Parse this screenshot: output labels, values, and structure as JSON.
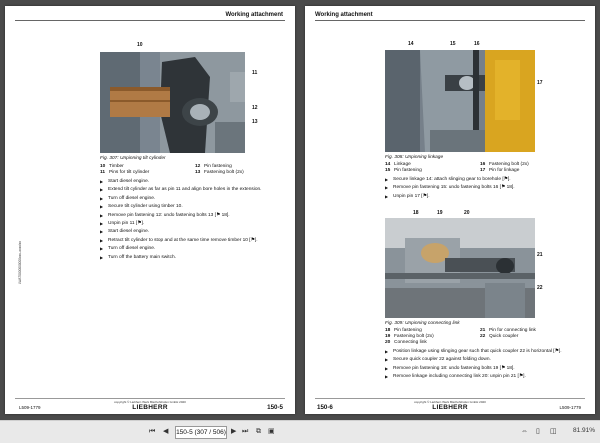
{
  "header_title": "Working attachment",
  "left_page": {
    "callouts": {
      "c10": "10",
      "c11": "11",
      "c12": "12",
      "c13": "13"
    },
    "caption": "Fig. 307: Unpinning tilt cylinder",
    "legend": [
      [
        "10",
        "Timber",
        "12",
        "Pin fastening"
      ],
      [
        "11",
        "Pins for tilt cylinder",
        "13",
        "Fastening bolt (2x)"
      ]
    ],
    "steps": [
      "Start diesel engine.",
      "Extend tilt cylinder as far as pin 11 and align bore holes in the extension.",
      "Turn off diesel engine.",
      "Secure tilt cylinder using timber 10.",
      "Remove pin fastening 12: undo fastening bolts 13 [⚑ 18].",
      "Unpin pin 11 [⚑].",
      "Start diesel engine.",
      "Retract tilt cylinder to stop and at the same time remove timber 10 [⚑].",
      "Turn off diesel engine.",
      "Turn off the battery main switch."
    ],
    "side_code": "LWAT0000000000xxx–xxxx/xx",
    "footer_code": "L509-1779",
    "footer_copy": "copyright © Liebherr-Werk Bischofshofen GmbH 2020",
    "footer_logo": "LIEBHERR",
    "page_number": "150-5"
  },
  "right_page": {
    "fig1_callouts": {
      "c14": "14",
      "c15": "15",
      "c16": "16",
      "c17": "17"
    },
    "fig1_caption": "Fig. 308: Unpinning linkage",
    "fig1_legend": [
      [
        "14",
        "Linkage",
        "16",
        "Fastening bolt (2x)"
      ],
      [
        "15",
        "Pin fastening",
        "17",
        "Pin for linkage"
      ]
    ],
    "fig1_steps": [
      "Secure linkage 14: attach slinging gear to borehole [⚑].",
      "Remove pin fastening 15: undo fastening bolts 16 [⚑ 18].",
      "Unpin pin 17 [⚑]."
    ],
    "fig2_callouts": {
      "c18": "18",
      "c19": "19",
      "c20": "20",
      "c21": "21",
      "c22": "22"
    },
    "fig2_caption": "Fig. 309: Unpinning connecting link",
    "fig2_legend": [
      [
        "18",
        "Pin fastening",
        "21",
        "Pin for connecting link"
      ],
      [
        "19",
        "Fastening bolt (2x)",
        "22",
        "Quick coupler"
      ],
      [
        "20",
        "Connecting link",
        "",
        ""
      ]
    ],
    "fig2_steps": [
      "Position linkage using slinging gear such that quick coupler 22 is horizontal [⚑].",
      "Secure quick coupler 22 against folding down.",
      "Remove pin fastening 18: undo fastening bolts 19 [⚑ 18].",
      "Remove linkage including connecting link 20: unpin pin 21 [⚑]."
    ],
    "footer_code": "L509-1779",
    "footer_copy": "copyright © Liebherr-Werk Bischofshofen GmbH 2020",
    "footer_logo": "LIEBHERR",
    "page_number": "150-6"
  },
  "viewer": {
    "page_indicator": "150-5 (307 / 506)",
    "zoom": "81.91%",
    "icons": [
      "first-page-icon",
      "prev-page-icon",
      "next-page-icon",
      "last-page-icon",
      "copy-icon",
      "page-view-icon",
      "fit-width-icon",
      "single-page-icon",
      "two-page-icon"
    ]
  }
}
